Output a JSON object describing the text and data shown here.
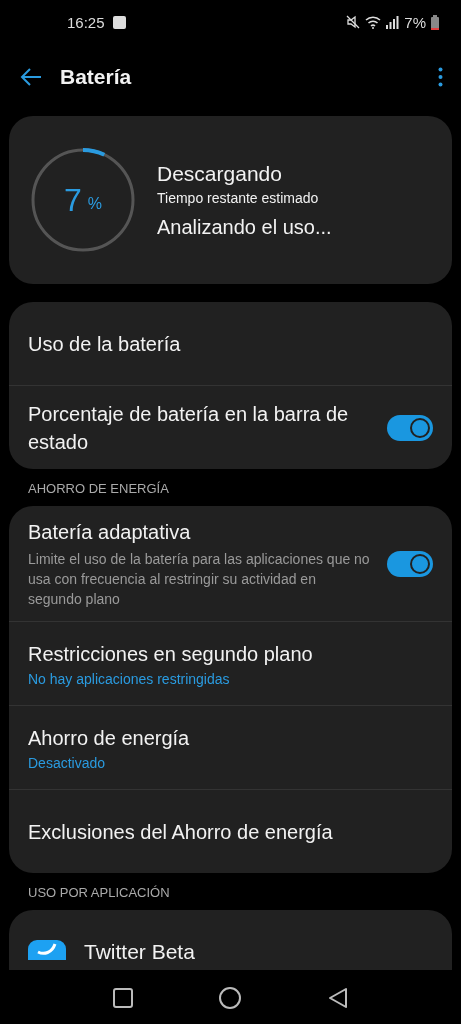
{
  "status_bar": {
    "time": "16:25",
    "battery": "7%"
  },
  "header": {
    "title": "Batería"
  },
  "battery_card": {
    "percent": "7",
    "unit": "%",
    "level": 0.07,
    "status": "Descargando",
    "subtitle": "Tiempo restante estimado",
    "estimate": "Analizando el uso..."
  },
  "general": [
    {
      "kind": "link",
      "title": "Uso de la batería"
    },
    {
      "kind": "toggle",
      "title": "Porcentaje de batería en la barra de estado",
      "on": true
    }
  ],
  "power_section": {
    "title": "AHORRO DE ENERGÍA",
    "items": [
      {
        "kind": "toggle",
        "title": "Batería adaptativa",
        "description": "Limite el uso de la batería para las aplicaciones que no usa con frecuencia al restringir su actividad en segundo plano",
        "on": true
      },
      {
        "kind": "link",
        "title": "Restricciones en segundo plano",
        "summary": "No hay aplicaciones restringidas"
      },
      {
        "kind": "link",
        "title": "Ahorro de energía",
        "summary": "Desactivado"
      },
      {
        "kind": "link",
        "title": "Exclusiones del Ahorro de energía"
      }
    ]
  },
  "apps_section": {
    "title": "USO POR APLICACIÓN",
    "apps": [
      {
        "name": "Twitter Beta"
      }
    ]
  }
}
